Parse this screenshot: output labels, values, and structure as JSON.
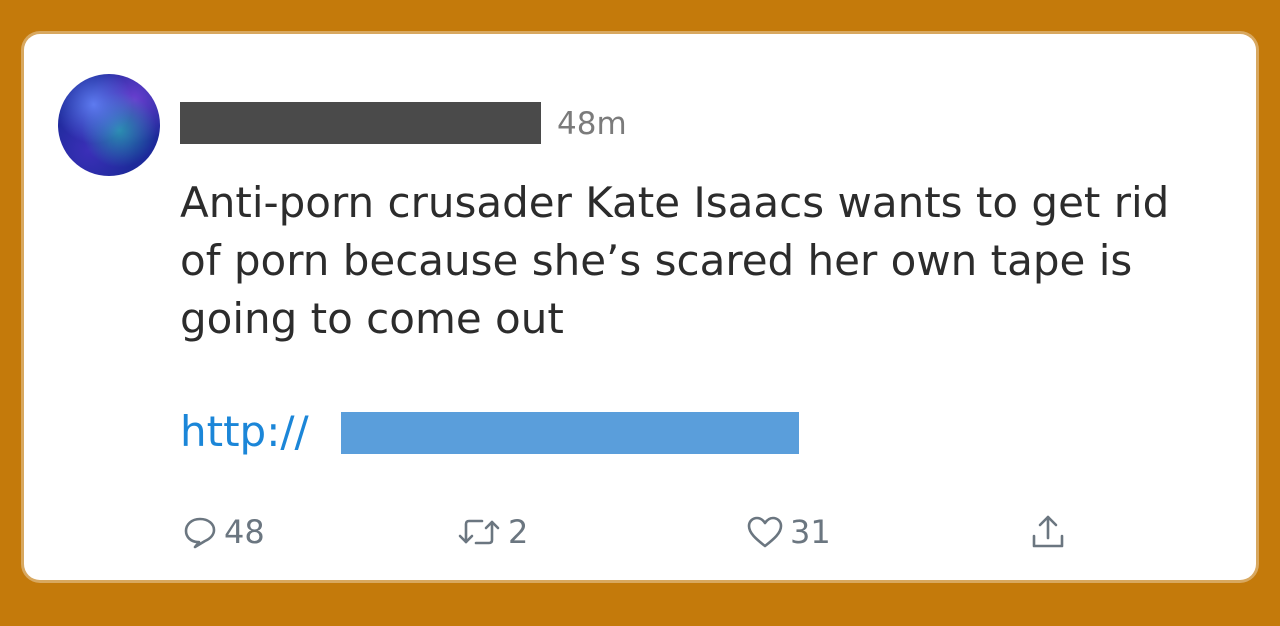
{
  "tweet": {
    "timestamp": "48m",
    "text": "Anti-porn crusader Kate Isaacs wants to get rid of porn because she’s scared her own tape is going to come out",
    "link_prefix": "http://"
  },
  "actions": {
    "reply_count": "48",
    "retweet_count": "2",
    "like_count": "31"
  },
  "colors": {
    "background": "#c47a0b",
    "card": "#ffffff",
    "link": "#1b86d8",
    "redaction": "#4a4a4a",
    "link_redaction": "#5a9edb",
    "icon": "#6b7680"
  },
  "icons": [
    "reply-icon",
    "retweet-icon",
    "like-icon",
    "share-icon"
  ]
}
